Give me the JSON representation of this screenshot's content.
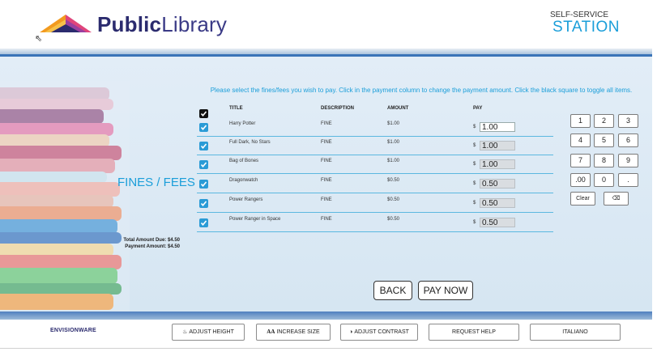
{
  "header": {
    "brand_bold": "Public",
    "brand_light": "Library",
    "station_line1": "SELF-SERVICE",
    "station_line2": "STATION"
  },
  "page": {
    "section_title": "FINES / FEES",
    "instructions": "Please select the fines/fees you wish to pay. Click in the payment column to change the payment amount. Click the black square to toggle all items.",
    "total_due": "Total Amount Due: $4.50",
    "payment_amount": "Payment Amount: $4.50"
  },
  "table": {
    "headers": {
      "title": "TITLE",
      "description": "DESCRIPTION",
      "amount": "AMOUNT",
      "pay": "PAY"
    },
    "currency": "$",
    "rows": [
      {
        "title": "Harry Potter",
        "description": "FINE",
        "amount": "$1.00",
        "pay": "1.00",
        "checked": true
      },
      {
        "title": "Full Dark, No Stars",
        "description": "FINE",
        "amount": "$1.00",
        "pay": "1.00",
        "checked": true
      },
      {
        "title": "Bag of Bones",
        "description": "FINE",
        "amount": "$1.00",
        "pay": "1.00",
        "checked": true
      },
      {
        "title": "Dragonwatch",
        "description": "FINE",
        "amount": "$0.50",
        "pay": "0.50",
        "checked": true
      },
      {
        "title": "Power Rangers",
        "description": "FINE",
        "amount": "$0.50",
        "pay": "0.50",
        "checked": true
      },
      {
        "title": "Power Ranger in Space",
        "description": "FINE",
        "amount": "$0.50",
        "pay": "0.50",
        "checked": true
      }
    ]
  },
  "keypad": {
    "keys": [
      "1",
      "2",
      "3",
      "4",
      "5",
      "6",
      "7",
      "8",
      "9",
      ".00",
      "0",
      "."
    ],
    "clear": "Clear",
    "backspace": "⌫"
  },
  "actions": {
    "back": "BACK",
    "pay_now": "PAY NOW"
  },
  "footer": {
    "logo_text": "ENVISIONWARE",
    "adjust_height": "ADJUST HEIGHT",
    "increase_size": "INCREASE SIZE",
    "increase_size_icon": "AA",
    "adjust_contrast": "ADJUST CONTRAST",
    "request_help": "REQUEST HELP",
    "language": "ITALIANO"
  },
  "colors": {
    "accent": "#1a9ed9",
    "brand": "#2b2b6e",
    "checkbox": "#2a9bd6"
  }
}
